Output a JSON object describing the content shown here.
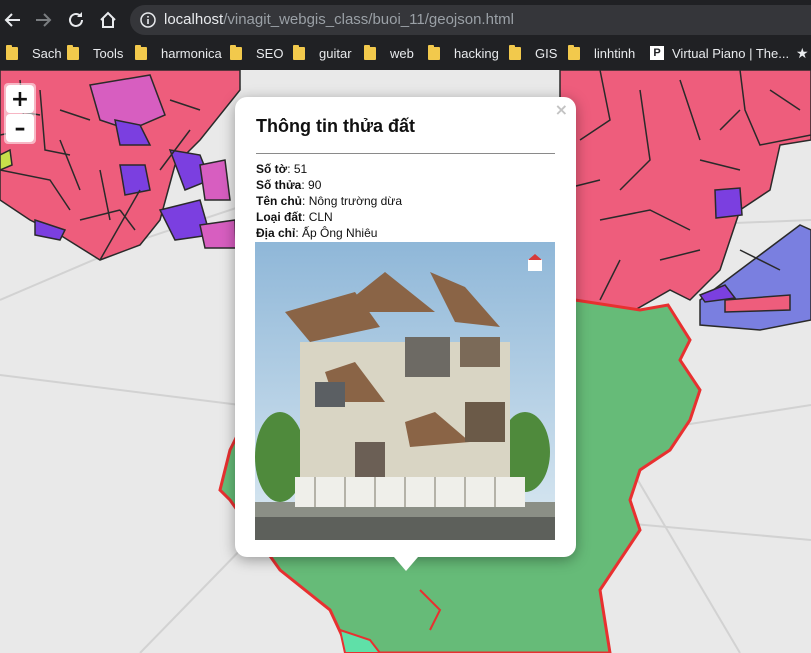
{
  "browser": {
    "url_host": "localhost",
    "url_path": "/vinagit_webgis_class/buoi_11/geojson.html",
    "bookmarks": [
      "Sach",
      "Tools",
      "harmonica",
      "SEO",
      "guitar",
      "web",
      "hacking",
      "GIS",
      "linhtinh",
      "Virtual Piano | The..."
    ],
    "overflow_icon": "star-icon"
  },
  "map": {
    "zoom_in_label": "+",
    "zoom_out_label": "–",
    "colors": {
      "parcel_pink": "#ee5d7c",
      "parcel_magenta": "#d75ec0",
      "parcel_violet": "#7b3fe0",
      "parcel_blue": "#7a7fe0",
      "parcel_green": "#66bb78",
      "highlight_red": "#e83030"
    }
  },
  "popup": {
    "title": "Thông tin thửa đất",
    "close_label": "×",
    "fields": [
      {
        "label": "Số tờ",
        "value": "51"
      },
      {
        "label": "Số thửa",
        "value": "90"
      },
      {
        "label": "Tên chủ",
        "value": "Nông trường dừa"
      },
      {
        "label": "Loại đất",
        "value": "CLN"
      },
      {
        "label": "Địa chỉ",
        "value": "Ấp Ông Nhiêu"
      }
    ],
    "photo_icon": "house-photo"
  }
}
